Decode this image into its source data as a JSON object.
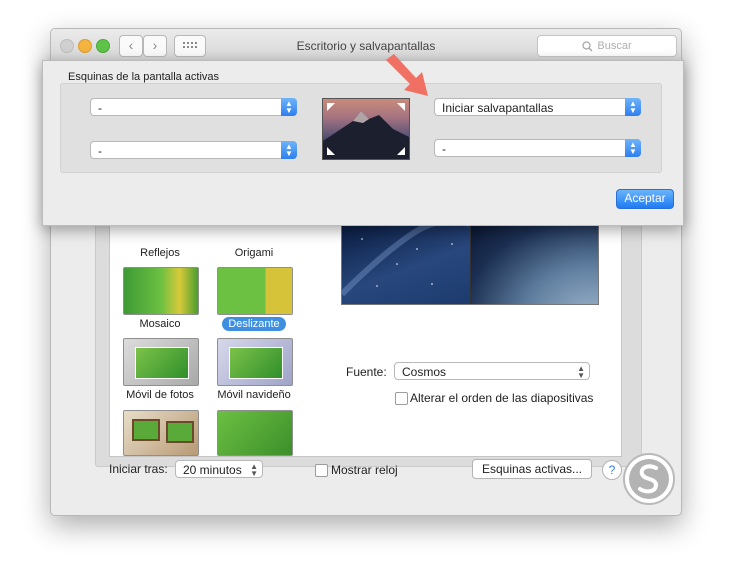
{
  "window": {
    "title": "Escritorio y salvapantallas",
    "search_placeholder": "Buscar",
    "back_glyph": "‹",
    "forward_glyph": "›"
  },
  "thumbnails": [
    {
      "label": "Reflejos",
      "selected": false
    },
    {
      "label": "Origami",
      "selected": false
    },
    {
      "label": "Mosaico",
      "selected": false
    },
    {
      "label": "Deslizante",
      "selected": true
    },
    {
      "label": "Móvil de fotos",
      "selected": false
    },
    {
      "label": "Móvil navideño",
      "selected": false
    }
  ],
  "options": {
    "source_label": "Fuente:",
    "source_value": "Cosmos",
    "shuffle_label": "Alterar el orden de las diapositivas"
  },
  "footer": {
    "start_after_label": "Iniciar tras:",
    "start_after_value": "20 minutos",
    "show_clock_label": "Mostrar reloj",
    "hot_corners_button": "Esquinas activas...",
    "help_glyph": "?"
  },
  "sheet": {
    "title": "Esquinas de la pantalla activas",
    "top_left": "-",
    "top_right": "Iniciar salvapantallas",
    "bottom_left": "-",
    "bottom_right": "-",
    "accept_button": "Aceptar"
  },
  "colors": {
    "accent": "#2d7ff0",
    "arrow": "#f07064",
    "selection": "#3f8fe0"
  },
  "icons": {
    "search": "search-icon",
    "grid": "grid-icon",
    "arrow": "arrow-icon",
    "logo": "brand-logo"
  }
}
